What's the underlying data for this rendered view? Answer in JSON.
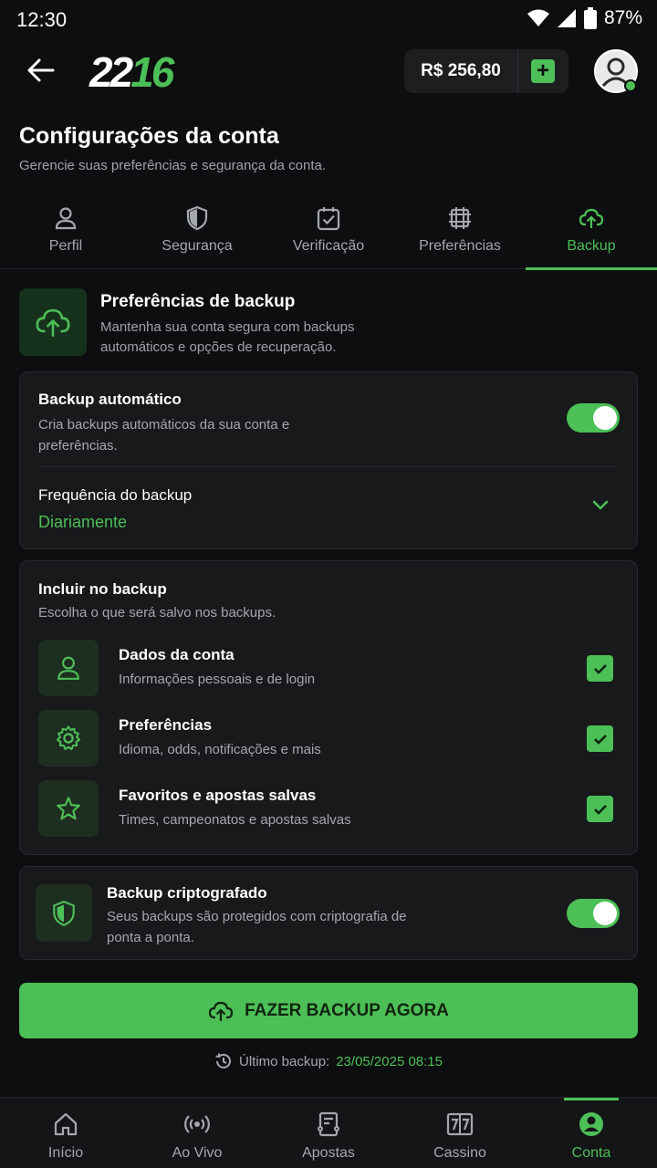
{
  "status_bar": {
    "time": "12:30",
    "battery": "87%"
  },
  "header": {
    "logo_white": "22",
    "logo_green": "16",
    "balance": "R$ 256,80"
  },
  "page": {
    "title": "Configurações da conta",
    "subtitle": "Gerencie suas preferências e segurança da conta."
  },
  "tabs": [
    {
      "label": "Perfil",
      "icon": "user-icon"
    },
    {
      "label": "Segurança",
      "icon": "shield-icon"
    },
    {
      "label": "Verificação",
      "icon": "check-square-icon"
    },
    {
      "label": "Preferências",
      "icon": "sliders-icon"
    },
    {
      "label": "Backup",
      "icon": "cloud-upload-icon",
      "active": true
    }
  ],
  "section": {
    "title": "Preferências de backup",
    "description": "Mantenha sua conta segura com backups automáticos e opções de recuperação."
  },
  "auto_backup": {
    "title": "Backup automático",
    "description": "Cria backups automáticos da sua conta e preferências.",
    "enabled": true,
    "frequency_label": "Frequência do backup",
    "frequency_value": "Diariamente"
  },
  "include": {
    "title": "Incluir no backup",
    "description": "Escolha o que será salvo nos backups.",
    "items": [
      {
        "title": "Dados da conta",
        "description": "Informações pessoais e de login",
        "icon": "user-icon",
        "checked": true
      },
      {
        "title": "Preferências",
        "description": "Idioma, odds, notificações e mais",
        "icon": "gear-icon",
        "checked": true
      },
      {
        "title": "Favoritos e apostas salvas",
        "description": "Times, campeonatos e apostas salvas",
        "icon": "star-icon",
        "checked": true
      }
    ]
  },
  "encrypted": {
    "title": "Backup criptografado",
    "description": "Seus backups são protegidos com criptografia de ponta a ponta.",
    "enabled": true
  },
  "cta": {
    "label": "FAZER BACKUP AGORA"
  },
  "last_backup": {
    "label": "Último backup:",
    "value": "23/05/2025 08:15"
  },
  "bottom_nav": [
    {
      "label": "Início",
      "icon": "home-icon"
    },
    {
      "label": "Ao Vivo",
      "icon": "live-icon"
    },
    {
      "label": "Apostas",
      "icon": "ticket-icon"
    },
    {
      "label": "Cassino",
      "icon": "slot-777-icon"
    },
    {
      "label": "Conta",
      "icon": "account-icon",
      "active": true
    }
  ],
  "colors": {
    "accent": "#4dbf57",
    "background": "#0d0e0f",
    "card": "#17191b"
  }
}
